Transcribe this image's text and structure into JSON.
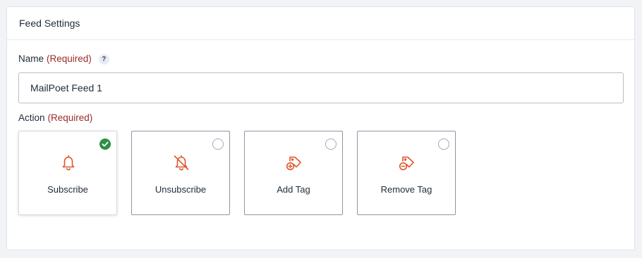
{
  "panel": {
    "title": "Feed Settings"
  },
  "name_field": {
    "label": "Name",
    "required": "(Required)",
    "help": "?",
    "value": "MailPoet Feed 1"
  },
  "action_field": {
    "label": "Action",
    "required": "(Required)",
    "options": [
      {
        "label": "Subscribe",
        "icon": "bell-icon",
        "selected": true
      },
      {
        "label": "Unsubscribe",
        "icon": "bell-off-icon",
        "selected": false
      },
      {
        "label": "Add Tag",
        "icon": "tag-add-icon",
        "selected": false
      },
      {
        "label": "Remove Tag",
        "icon": "tag-remove-icon",
        "selected": false
      }
    ]
  },
  "colors": {
    "icon_accent": "#e0552b",
    "required": "#9a2b2b",
    "selected_check": "#2f8f46"
  }
}
